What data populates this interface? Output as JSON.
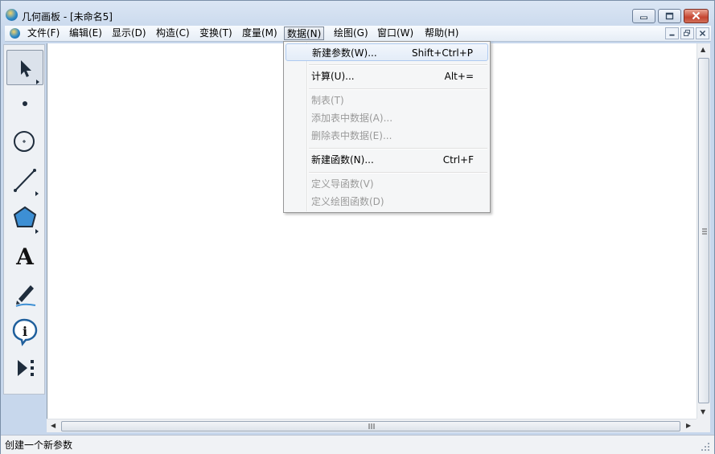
{
  "window": {
    "title": "几何画板 - [未命名5]"
  },
  "menubar": {
    "items": [
      {
        "label": "文件(F)"
      },
      {
        "label": "编辑(E)"
      },
      {
        "label": "显示(D)"
      },
      {
        "label": "构造(C)"
      },
      {
        "label": "变换(T)"
      },
      {
        "label": "度量(M)"
      },
      {
        "label": "数据(N)",
        "active": true
      },
      {
        "label": "绘图(G)"
      },
      {
        "label": "窗口(W)"
      },
      {
        "label": "帮助(H)"
      }
    ]
  },
  "data_menu": {
    "items": [
      {
        "label": "新建参数(W)...",
        "shortcut": "Shift+Ctrl+P",
        "enabled": true,
        "highlighted": true
      },
      {
        "label": "计算(U)...",
        "shortcut": "Alt+=",
        "enabled": true
      },
      {
        "label": "制表(T)",
        "shortcut": "",
        "enabled": false
      },
      {
        "label": "添加表中数据(A)...",
        "shortcut": "",
        "enabled": false
      },
      {
        "label": "删除表中数据(E)...",
        "shortcut": "",
        "enabled": false
      },
      {
        "label": "新建函数(N)...",
        "shortcut": "Ctrl+F",
        "enabled": true
      },
      {
        "label": "定义导函数(V)",
        "shortcut": "",
        "enabled": false
      },
      {
        "label": "定义绘图函数(D)",
        "shortcut": "",
        "enabled": false
      }
    ]
  },
  "toolbox": {
    "tools": [
      {
        "icon": "arrow-select-icon",
        "selected": true
      },
      {
        "icon": "point-tool-icon"
      },
      {
        "icon": "compass-circle-icon"
      },
      {
        "icon": "straightedge-line-icon"
      },
      {
        "icon": "polygon-tool-icon"
      },
      {
        "icon": "text-tool-icon",
        "glyph": "A"
      },
      {
        "icon": "marker-pen-icon"
      },
      {
        "icon": "information-icon",
        "glyph": "i"
      },
      {
        "icon": "custom-tool-icon"
      }
    ]
  },
  "statusbar": {
    "text": "创建一个新参数"
  },
  "colors": {
    "polygon_fill": "#3d8fd4",
    "close_button": "#c54430",
    "menu_highlight": "#e3ecf8"
  }
}
